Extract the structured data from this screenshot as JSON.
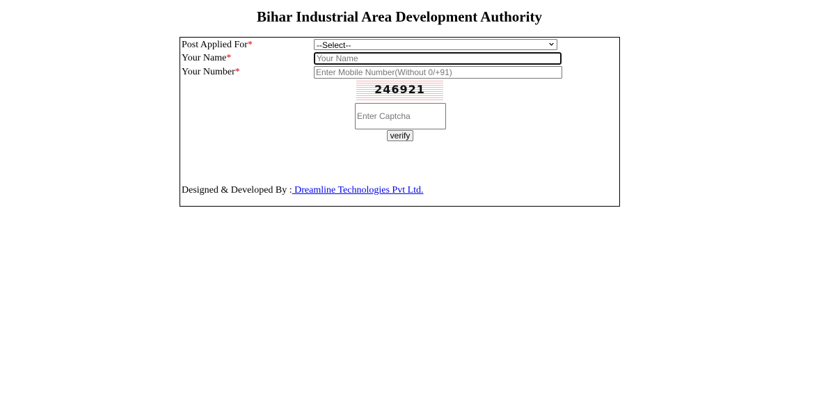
{
  "page": {
    "title": "Bihar Industrial Area Development Authority"
  },
  "form": {
    "post_label": "Post Applied For",
    "post_required": "*",
    "post_selected": "--Select--",
    "name_label": "Your Name",
    "name_required": "*",
    "name_placeholder": "Your Name",
    "name_value": "",
    "number_label": "Your Number",
    "number_required": "*",
    "number_placeholder": "Enter Mobile Number(Without 0/+91)",
    "number_value": "",
    "captcha_code": "246921",
    "captcha_placeholder": "Enter Captcha",
    "verify_label": "verify"
  },
  "footer": {
    "prefix": "Designed & Developed By :",
    "link_text": " Dreamline Technologies Pvt Ltd."
  },
  "colors": {
    "required_marker": "#e00000",
    "link": "#0000ee",
    "captcha_lines": "#f3b4b4"
  },
  "icons": {
    "select_arrow": "chevron-down-icon"
  }
}
